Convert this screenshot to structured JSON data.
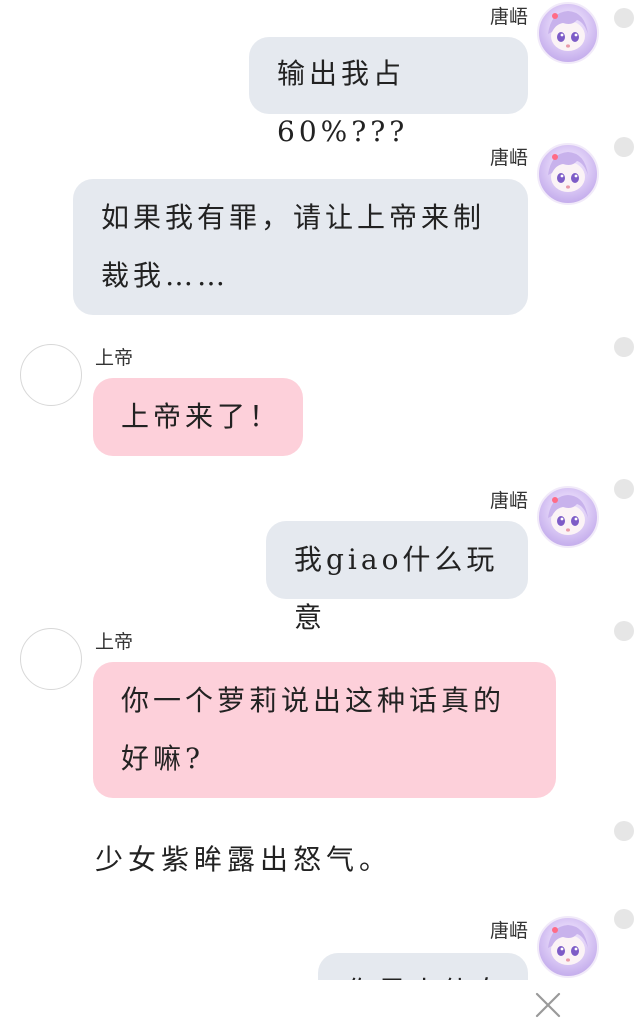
{
  "messages": [
    {
      "sender": "唐峿",
      "side": "me",
      "text": "输出我占60%???"
    },
    {
      "sender": "唐峿",
      "side": "me",
      "text": "如果我有罪，请让上帝来制裁我……"
    },
    {
      "sender": "上帝",
      "side": "god",
      "text": "上帝来了！"
    },
    {
      "sender": "唐峿",
      "side": "me",
      "text": "我giao什么玩意"
    },
    {
      "sender": "上帝",
      "side": "god",
      "text": "你一个萝莉说出这种话真的好嘛?"
    },
    {
      "sender": "唐峿",
      "side": "me",
      "text": "你是小仙女"
    }
  ],
  "narration": "少女紫眸露出怒气。",
  "colors": {
    "my_bubble": "#e5e9ef",
    "god_bubble": "#fdd0da",
    "side_dot": "#e6e6e6"
  },
  "icons": {
    "close": "close-icon",
    "avatar_me": "anime-girl-avatar",
    "avatar_god": "empty-avatar"
  }
}
